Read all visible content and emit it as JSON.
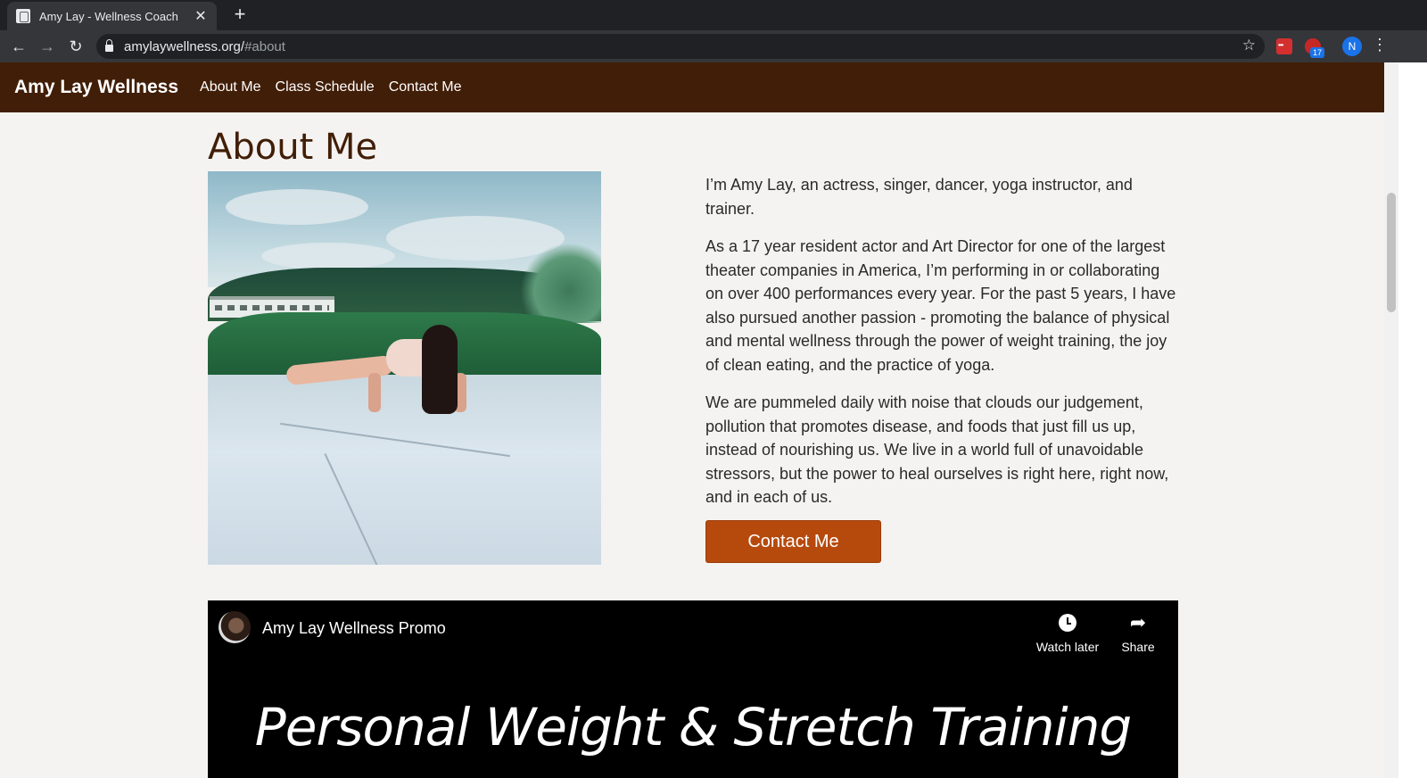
{
  "browser": {
    "tab_title": "Amy Lay - Wellness Coach",
    "url_host": "amylaywellness.org/",
    "url_path": "#about",
    "extension_badge": "17",
    "profile_initial": "N"
  },
  "site": {
    "brand": "Amy Lay Wellness",
    "nav": [
      "About Me",
      "Class Schedule",
      "Contact Me"
    ],
    "heading": "About Me",
    "bio": [
      "I’m Amy Lay, an actress, singer, dancer, yoga instructor, and trainer.",
      "As a 17 year resident actor and Art Director for one of the largest theater companies in America, I’m performing in or collaborating on over 400 performances every year. For the past 5 years, I have also pursued another passion - promoting the balance of physical and mental wellness through the power of weight training, the joy of clean eating, and the practice of yoga.",
      "We are pummeled daily with noise that clouds our judgement, pollution that promotes disease, and foods that just fill us up, instead of nourishing us. We live in a world full of unavoidable stressors, but the power to heal ourselves is right here, right now, and in each of us."
    ],
    "contact_button": "Contact Me",
    "video": {
      "title": "Amy Lay Wellness Promo",
      "watch_later": "Watch later",
      "share": "Share",
      "slogan": "Personal Weight & Stretch Training"
    }
  },
  "colors": {
    "nav_bg": "#411e07",
    "button_bg": "#b64a0d",
    "page_bg": "#f5f3f1"
  },
  "icons": [
    "back-arrow-icon",
    "forward-arrow-icon",
    "reload-icon",
    "lock-icon",
    "star-icon",
    "menu-dots-icon",
    "clock-icon",
    "share-arrow-icon"
  ]
}
